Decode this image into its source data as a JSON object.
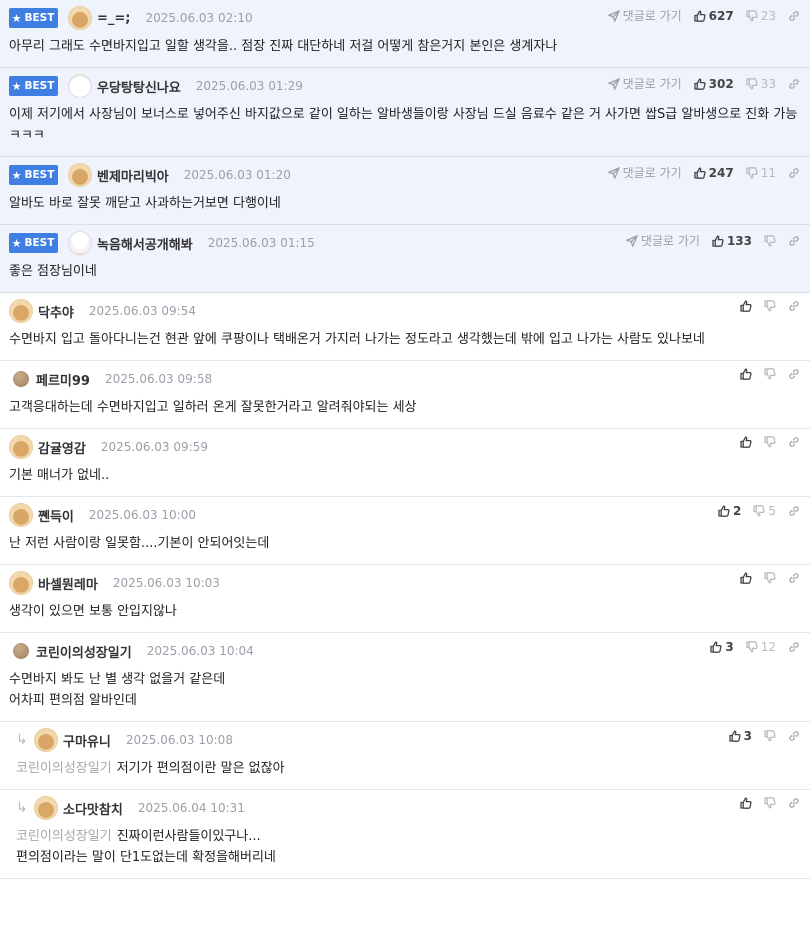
{
  "ui": {
    "best_label": "BEST",
    "reply_to_label": "댓글로 가기",
    "colors": {
      "accent": "#3f7fe3",
      "best_bg": "#eef3fc",
      "meta_gray": "#9aa0a8"
    }
  },
  "comments": [
    {
      "best": true,
      "avatar": "dog",
      "nickname": "=_=;",
      "date": "2025.06.03 02:10",
      "upvotes": "627",
      "downvotes": "23",
      "text": "아무리 그래도 수면바지입고 일할 생각을.. 점장 진짜 대단하네 저걸 어떻게 참은거지 본인은 생계자나"
    },
    {
      "best": true,
      "avatar": "white",
      "nickname": "우당탕탕신나요",
      "date": "2025.06.03 01:29",
      "upvotes": "302",
      "downvotes": "33",
      "text": "이제 저기에서 사장님이 보너스로 넣어주신 바지값으로 같이 일하는 알바생들이랑 사장님 드실 음료수 같은 거 사가면 쌉S급 알바생으로 진화 가능 ㅋㅋㅋ"
    },
    {
      "best": true,
      "avatar": "dog",
      "nickname": "벤제마리빅아",
      "date": "2025.06.03 01:20",
      "upvotes": "247",
      "downvotes": "11",
      "text": "알바도 바로 잘못 깨닫고 사과하는거보면 다행이네"
    },
    {
      "best": true,
      "avatar": "xmas",
      "nickname": "녹음해서공개해봐",
      "date": "2025.06.03 01:15",
      "upvotes": "133",
      "downvotes": "",
      "text": "좋은 점장님이네"
    },
    {
      "best": false,
      "avatar": "dog",
      "nickname": "닥추야",
      "date": "2025.06.03 09:54",
      "upvotes": "",
      "downvotes": "",
      "text": "수면바지 입고 돌아다니는건 현관 앞에 쿠팡이나 택배온거 가지러 나가는 정도라고 생각했는데 밖에 입고 나가는 사람도 있나보네"
    },
    {
      "best": false,
      "avatar": "ball",
      "nickname": "페르미99",
      "date": "2025.06.03 09:58",
      "upvotes": "",
      "downvotes": "",
      "text": "고객응대하는데 수면바지입고 일하러 온게 잘못한거라고 알려줘야되는 세상"
    },
    {
      "best": false,
      "avatar": "dog",
      "nickname": "감귤영감",
      "date": "2025.06.03 09:59",
      "upvotes": "",
      "downvotes": "",
      "text": "기본 매너가 없네.."
    },
    {
      "best": false,
      "avatar": "dog",
      "nickname": "쪤득이",
      "date": "2025.06.03 10:00",
      "upvotes": "2",
      "downvotes": "5",
      "text": "난 저런 사람이랑 일못함....기본이 안되어잇는데"
    },
    {
      "best": false,
      "avatar": "dog",
      "nickname": "바셀뭔레마",
      "date": "2025.06.03 10:03",
      "upvotes": "",
      "downvotes": "",
      "text": "생각이 있으면 보통 안입지않나"
    },
    {
      "best": false,
      "avatar": "ball",
      "nickname": "코린이의성장일기",
      "date": "2025.06.03 10:04",
      "upvotes": "3",
      "downvotes": "12",
      "text": "수면바지 봐도 난 별 생각 없을거 같은데\n어차피 편의점 알바인데"
    },
    {
      "best": false,
      "reply": true,
      "avatar": "dog",
      "nickname": "구마유니",
      "date": "2025.06.03 10:08",
      "upvotes": "3",
      "downvotes": "",
      "mention": "코린이의성장일기",
      "text": "저기가 편의점이란 말은 없잖아"
    },
    {
      "best": false,
      "reply": true,
      "avatar": "dog",
      "nickname": "소다맛참치",
      "date": "2025.06.04 10:31",
      "upvotes": "",
      "downvotes": "",
      "mention": "코린이의성장일기",
      "text": "진짜이런사람들이있구나...\n편의점이라는 말이 단1도없는데 확정을해버리네"
    }
  ]
}
